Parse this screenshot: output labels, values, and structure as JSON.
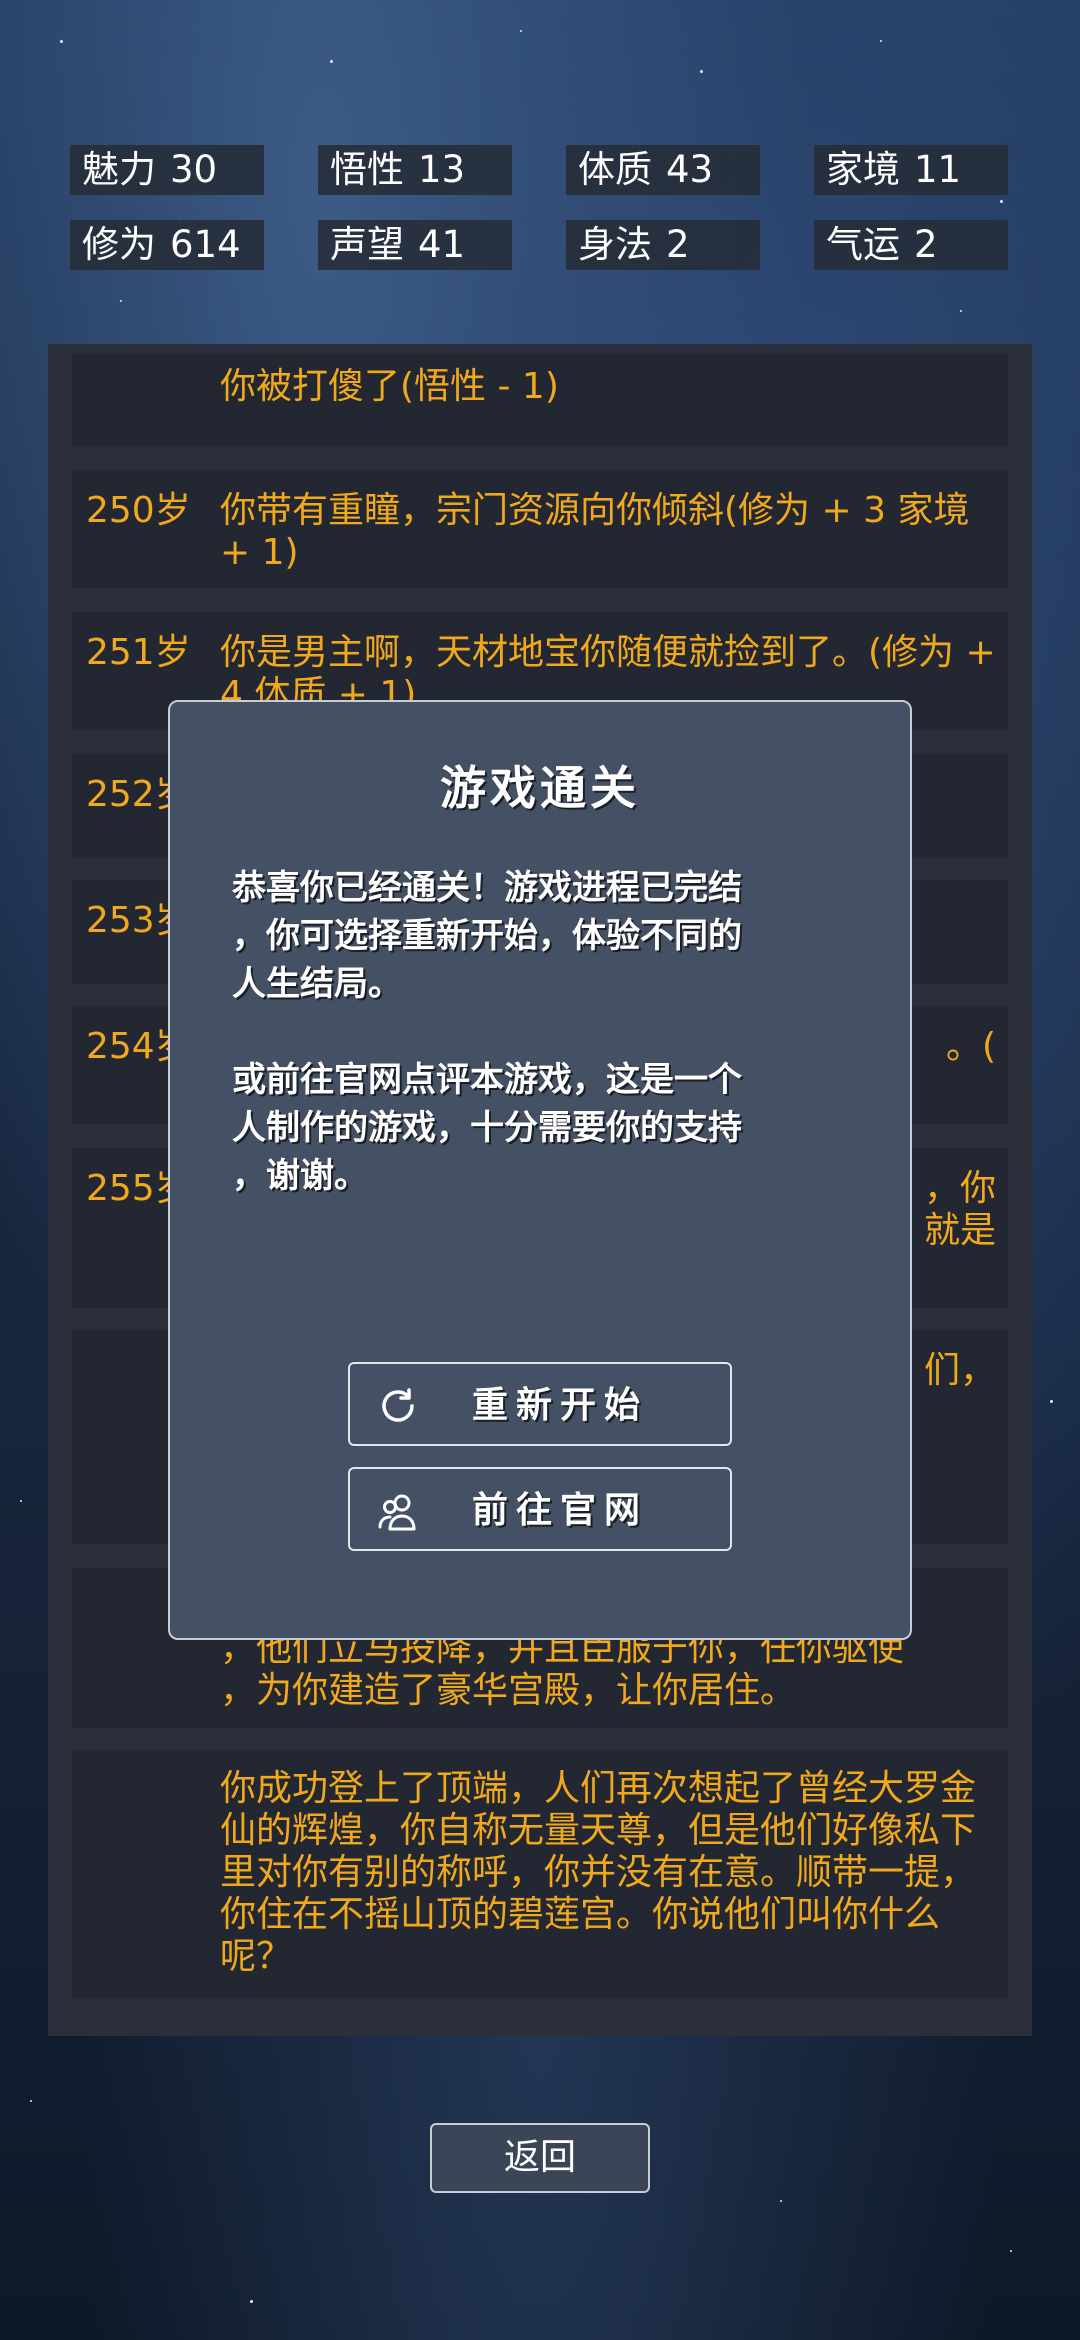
{
  "stats": [
    {
      "label": "魅力",
      "value": "30"
    },
    {
      "label": "悟性",
      "value": "13"
    },
    {
      "label": "体质",
      "value": "43"
    },
    {
      "label": "家境",
      "value": "11"
    },
    {
      "label": "修为",
      "value": "614"
    },
    {
      "label": "声望",
      "value": "41"
    },
    {
      "label": "身法",
      "value": "2"
    },
    {
      "label": "气运",
      "value": "2"
    }
  ],
  "log": [
    {
      "age": "",
      "text": "你被打傻了(悟性 - 1)"
    },
    {
      "age": "250岁",
      "text": "你带有重瞳，宗门资源向你倾斜(修为 + 3 家境 + 1)"
    },
    {
      "age": "251岁",
      "text": "你是男主啊，天材地宝你随便就捡到了。(修为 + 4 体质 + 1)"
    },
    {
      "age": "252岁",
      "text": ""
    },
    {
      "age": "253岁",
      "text": ""
    },
    {
      "age": "254岁",
      "text": "。("
    },
    {
      "age": "255岁",
      "text": "，你\n就是"
    },
    {
      "age": "",
      "text": "们，"
    },
    {
      "age": "",
      "text": "魄散\n，他们立马投降，并且臣服于你，任你驱使\n，为你建造了豪华宫殿，让你居住。"
    },
    {
      "age": "",
      "text": "你成功登上了顶端，人们再次想起了曾经大罗金仙的辉煌，你自称无量天尊，但是他们好像私下里对你有别的称呼，你并没有在意。顺带一提，你住在不摇山顶的碧莲宫。你说他们叫你什么呢？"
    }
  ],
  "modal": {
    "title": "游戏通关",
    "body": "恭喜你已经通关！游戏进程已完结\n，你可选择重新开始，体验不同的\n人生结局。\n\n或前往官网点评本游戏，这是一个\n人制作的游戏，十分需要你的支持\n，谢谢。",
    "restart_label": "重新开始",
    "restart_icon": "refresh-icon",
    "website_label": "前往官网",
    "website_icon": "users-icon"
  },
  "back_label": "返回",
  "colors": {
    "accent": "#f0a81c",
    "panel": "#2b2f3a",
    "modal": "#445064"
  }
}
